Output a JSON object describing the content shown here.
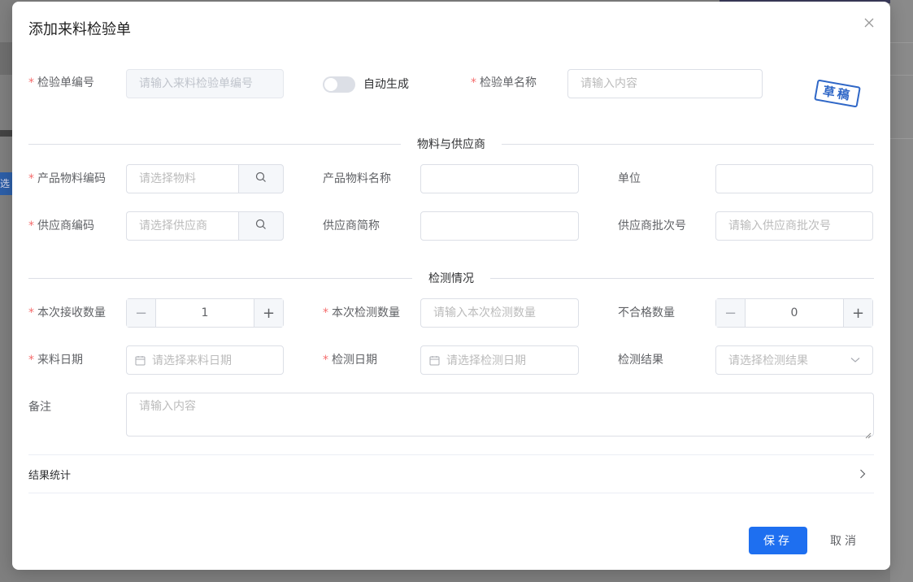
{
  "dialog": {
    "title": "添加来料检验单",
    "close_icon": "close-icon",
    "stamp_text": "草稿"
  },
  "basic": {
    "code_label": "检验单编号",
    "code_placeholder": "请输入来料检验单编号",
    "auto_label": "自动生成",
    "auto_on": false,
    "name_label": "检验单名称",
    "name_placeholder": "请输入内容"
  },
  "section_material": {
    "title": "物料与供应商",
    "item_code_label": "产品物料编码",
    "item_code_placeholder": "请选择物料",
    "item_name_label": "产品物料名称",
    "unit_label": "单位",
    "vendor_code_label": "供应商编码",
    "vendor_code_placeholder": "请选择供应商",
    "vendor_nick_label": "供应商简称",
    "vendor_batch_label": "供应商批次号",
    "vendor_batch_placeholder": "请输入供应商批次号"
  },
  "section_check": {
    "title": "检测情况",
    "recv_qty_label": "本次接收数量",
    "recv_qty_value": "1",
    "check_qty_label": "本次检测数量",
    "check_qty_placeholder": "请输入本次检测数量",
    "unqualified_label": "不合格数量",
    "unqualified_value": "0",
    "recv_date_label": "来料日期",
    "recv_date_placeholder": "请选择来料日期",
    "check_date_label": "检测日期",
    "check_date_placeholder": "请选择检测日期",
    "result_label": "检测结果",
    "result_placeholder": "请选择检测结果",
    "remark_label": "备注",
    "remark_placeholder": "请输入内容"
  },
  "collapse": {
    "title": "结果统计"
  },
  "footer": {
    "save_label": "保存",
    "cancel_label": "取消"
  },
  "background": {
    "side_tag": "选"
  },
  "colors": {
    "primary": "#1e6ff0",
    "required": "#f56c6c",
    "stamp": "#2f67c7"
  }
}
